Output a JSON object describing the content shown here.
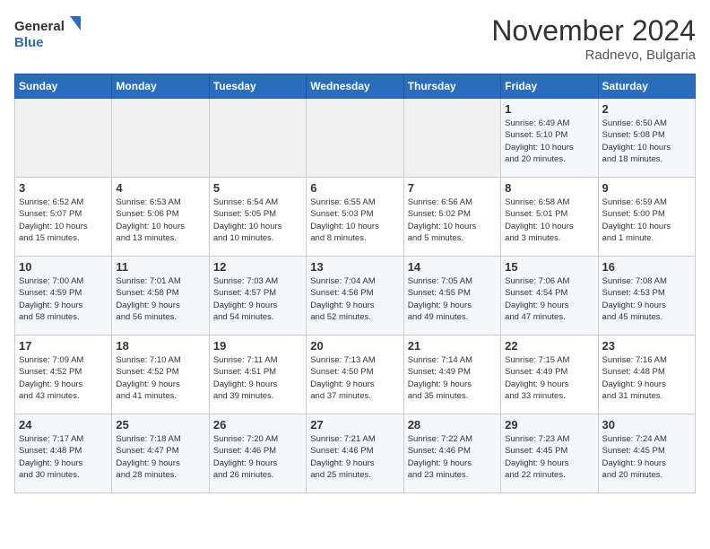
{
  "logo": {
    "line1": "General",
    "line2": "Blue"
  },
  "title": "November 2024",
  "location": "Radnevo, Bulgaria",
  "days_of_week": [
    "Sunday",
    "Monday",
    "Tuesday",
    "Wednesday",
    "Thursday",
    "Friday",
    "Saturday"
  ],
  "weeks": [
    [
      {
        "day": "",
        "info": ""
      },
      {
        "day": "",
        "info": ""
      },
      {
        "day": "",
        "info": ""
      },
      {
        "day": "",
        "info": ""
      },
      {
        "day": "",
        "info": ""
      },
      {
        "day": "1",
        "info": "Sunrise: 6:49 AM\nSunset: 5:10 PM\nDaylight: 10 hours\nand 20 minutes."
      },
      {
        "day": "2",
        "info": "Sunrise: 6:50 AM\nSunset: 5:08 PM\nDaylight: 10 hours\nand 18 minutes."
      }
    ],
    [
      {
        "day": "3",
        "info": "Sunrise: 6:52 AM\nSunset: 5:07 PM\nDaylight: 10 hours\nand 15 minutes."
      },
      {
        "day": "4",
        "info": "Sunrise: 6:53 AM\nSunset: 5:06 PM\nDaylight: 10 hours\nand 13 minutes."
      },
      {
        "day": "5",
        "info": "Sunrise: 6:54 AM\nSunset: 5:05 PM\nDaylight: 10 hours\nand 10 minutes."
      },
      {
        "day": "6",
        "info": "Sunrise: 6:55 AM\nSunset: 5:03 PM\nDaylight: 10 hours\nand 8 minutes."
      },
      {
        "day": "7",
        "info": "Sunrise: 6:56 AM\nSunset: 5:02 PM\nDaylight: 10 hours\nand 5 minutes."
      },
      {
        "day": "8",
        "info": "Sunrise: 6:58 AM\nSunset: 5:01 PM\nDaylight: 10 hours\nand 3 minutes."
      },
      {
        "day": "9",
        "info": "Sunrise: 6:59 AM\nSunset: 5:00 PM\nDaylight: 10 hours\nand 1 minute."
      }
    ],
    [
      {
        "day": "10",
        "info": "Sunrise: 7:00 AM\nSunset: 4:59 PM\nDaylight: 9 hours\nand 58 minutes."
      },
      {
        "day": "11",
        "info": "Sunrise: 7:01 AM\nSunset: 4:58 PM\nDaylight: 9 hours\nand 56 minutes."
      },
      {
        "day": "12",
        "info": "Sunrise: 7:03 AM\nSunset: 4:57 PM\nDaylight: 9 hours\nand 54 minutes."
      },
      {
        "day": "13",
        "info": "Sunrise: 7:04 AM\nSunset: 4:56 PM\nDaylight: 9 hours\nand 52 minutes."
      },
      {
        "day": "14",
        "info": "Sunrise: 7:05 AM\nSunset: 4:55 PM\nDaylight: 9 hours\nand 49 minutes."
      },
      {
        "day": "15",
        "info": "Sunrise: 7:06 AM\nSunset: 4:54 PM\nDaylight: 9 hours\nand 47 minutes."
      },
      {
        "day": "16",
        "info": "Sunrise: 7:08 AM\nSunset: 4:53 PM\nDaylight: 9 hours\nand 45 minutes."
      }
    ],
    [
      {
        "day": "17",
        "info": "Sunrise: 7:09 AM\nSunset: 4:52 PM\nDaylight: 9 hours\nand 43 minutes."
      },
      {
        "day": "18",
        "info": "Sunrise: 7:10 AM\nSunset: 4:52 PM\nDaylight: 9 hours\nand 41 minutes."
      },
      {
        "day": "19",
        "info": "Sunrise: 7:11 AM\nSunset: 4:51 PM\nDaylight: 9 hours\nand 39 minutes."
      },
      {
        "day": "20",
        "info": "Sunrise: 7:13 AM\nSunset: 4:50 PM\nDaylight: 9 hours\nand 37 minutes."
      },
      {
        "day": "21",
        "info": "Sunrise: 7:14 AM\nSunset: 4:49 PM\nDaylight: 9 hours\nand 35 minutes."
      },
      {
        "day": "22",
        "info": "Sunrise: 7:15 AM\nSunset: 4:49 PM\nDaylight: 9 hours\nand 33 minutes."
      },
      {
        "day": "23",
        "info": "Sunrise: 7:16 AM\nSunset: 4:48 PM\nDaylight: 9 hours\nand 31 minutes."
      }
    ],
    [
      {
        "day": "24",
        "info": "Sunrise: 7:17 AM\nSunset: 4:48 PM\nDaylight: 9 hours\nand 30 minutes."
      },
      {
        "day": "25",
        "info": "Sunrise: 7:18 AM\nSunset: 4:47 PM\nDaylight: 9 hours\nand 28 minutes."
      },
      {
        "day": "26",
        "info": "Sunrise: 7:20 AM\nSunset: 4:46 PM\nDaylight: 9 hours\nand 26 minutes."
      },
      {
        "day": "27",
        "info": "Sunrise: 7:21 AM\nSunset: 4:46 PM\nDaylight: 9 hours\nand 25 minutes."
      },
      {
        "day": "28",
        "info": "Sunrise: 7:22 AM\nSunset: 4:46 PM\nDaylight: 9 hours\nand 23 minutes."
      },
      {
        "day": "29",
        "info": "Sunrise: 7:23 AM\nSunset: 4:45 PM\nDaylight: 9 hours\nand 22 minutes."
      },
      {
        "day": "30",
        "info": "Sunrise: 7:24 AM\nSunset: 4:45 PM\nDaylight: 9 hours\nand 20 minutes."
      }
    ]
  ]
}
